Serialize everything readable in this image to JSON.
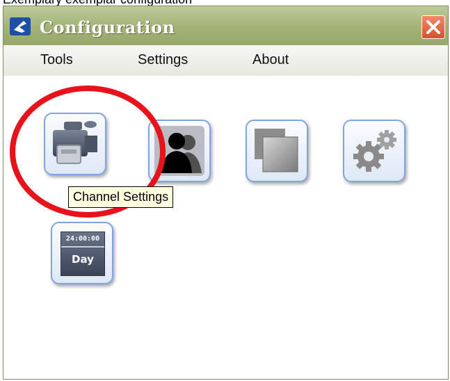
{
  "window": {
    "title": "Configuration"
  },
  "top_strip_text": "Exemplary exemplar configuration",
  "menu": {
    "tools": "Tools",
    "settings": "Settings",
    "about": "About"
  },
  "tiles": {
    "channel_settings": {
      "tooltip": "Channel Settings"
    },
    "day_schedule": {
      "time": "24:00:00",
      "label": "Day"
    }
  },
  "colors": {
    "titlebar": "#a3b277",
    "close": "#d9502d",
    "tile_border": "#7fa5e6",
    "highlight_circle": "#e8121a",
    "tooltip_bg": "#ffffe1"
  },
  "icons": [
    "app-logo-icon",
    "close-icon",
    "video-camera-icon",
    "users-icon",
    "layers-icon",
    "gears-icon",
    "day-schedule-icon"
  ]
}
